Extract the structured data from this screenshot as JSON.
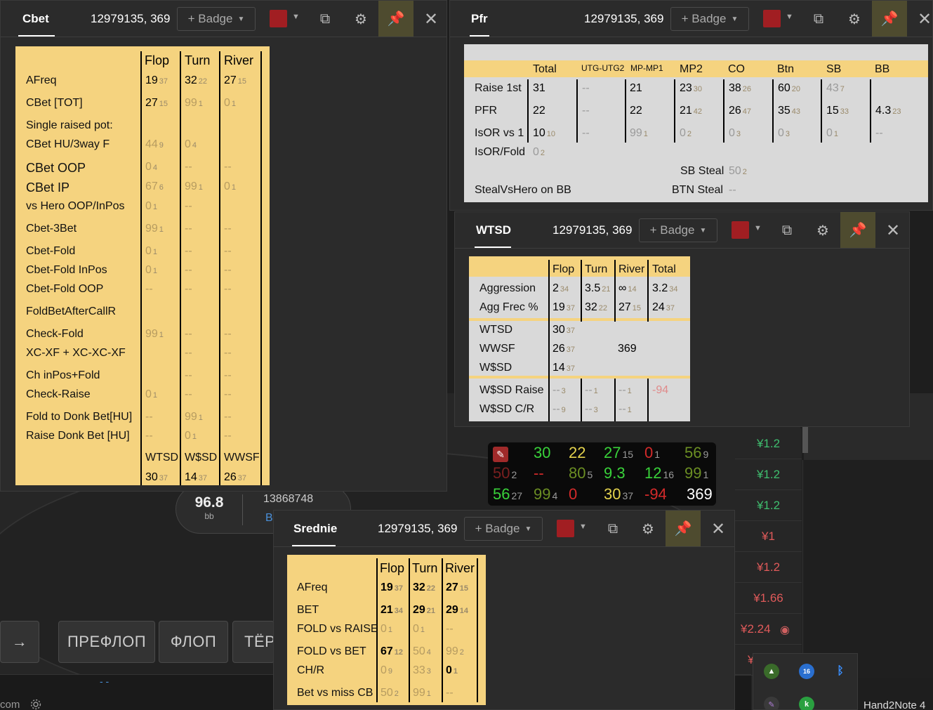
{
  "background": {
    "pot_bb": "96.8",
    "pot_unit": "bb",
    "table_id": "13868748",
    "table_b": "B",
    "arrow_btn": "→",
    "street_buttons": [
      "ПРЕФЛОП",
      "ФЛОП",
      "ТЁР"
    ],
    "bottom_text": "com",
    "dash": "- -",
    "right_values": [
      "¥1.2",
      "¥1.2",
      "¥1.2",
      "¥1",
      "¥1.2",
      "¥1.66",
      "¥2.24",
      "¥"
    ],
    "tray_badge": "16",
    "app_name": "Hand2Note 4"
  },
  "hud": {
    "rows": [
      [
        {
          "v": "30",
          "c": "c-g"
        },
        {
          "v": "22",
          "c": "c-y"
        },
        {
          "v": "27",
          "s": "15",
          "c": "c-g"
        },
        {
          "v": "0",
          "s": "1",
          "c": "c-r"
        },
        {
          "v": "56",
          "s": "9",
          "c": "c-ol"
        }
      ],
      [
        {
          "v": "50",
          "s": "2",
          "c": "c-dr"
        },
        {
          "v": "--",
          "c": "c-r"
        },
        {
          "v": "80",
          "s": "5",
          "c": "c-ol"
        },
        {
          "v": "9.3",
          "c": "c-g"
        },
        {
          "v": "12",
          "s": "16",
          "c": "c-g"
        },
        {
          "v": "99",
          "s": "1",
          "c": "c-ol"
        }
      ],
      [
        {
          "v": "56",
          "s": "27",
          "c": "c-g"
        },
        {
          "v": "99",
          "s": "4",
          "c": "c-ol"
        },
        {
          "v": "0",
          "c": "c-r"
        },
        {
          "v": "30",
          "s": "37",
          "c": "c-y"
        },
        {
          "v": "-94",
          "c": "c-r"
        },
        {
          "v": "369",
          "c": "c-w"
        }
      ]
    ]
  },
  "cbet": {
    "title": "Cbet",
    "player": "12979135, 369",
    "badge": "+ Badge",
    "headers": [
      "Flop",
      "Turn",
      "River"
    ],
    "rows": [
      {
        "label": "AFreq",
        "cells": [
          [
            "19",
            "37"
          ],
          [
            "32",
            "22"
          ],
          [
            "27",
            "15"
          ]
        ]
      },
      {
        "label": "CBet [TOT]",
        "cells": [
          [
            "27",
            "15"
          ],
          [
            "99",
            "1",
            "d"
          ],
          [
            "0",
            "1",
            "d"
          ]
        ]
      },
      {
        "label": "Single raised pot:",
        "cells": []
      },
      {
        "label": "CBet HU/3way F",
        "cells": [
          [
            "44",
            "9",
            "d"
          ],
          [
            "0",
            "4",
            "d"
          ],
          null
        ]
      },
      {
        "label": "CBet OOP",
        "cells": [
          [
            "0",
            "4",
            "d"
          ],
          [
            "--",
            "",
            "d"
          ],
          [
            "--",
            "",
            "d"
          ]
        ]
      },
      {
        "label": "CBet IP",
        "cells": [
          [
            "67",
            "6",
            "d"
          ],
          [
            "99",
            "1",
            "d"
          ],
          [
            "0",
            "1",
            "d"
          ]
        ]
      },
      {
        "label": "vs Hero OOP/InPos",
        "cells": [
          [
            "0",
            "1",
            "d"
          ],
          [
            "--",
            "",
            "d"
          ],
          null
        ]
      },
      {
        "label": "Cbet-3Bet",
        "cells": [
          [
            "99",
            "1",
            "d"
          ],
          [
            "--",
            "",
            "d"
          ],
          [
            "--",
            "",
            "d"
          ]
        ]
      },
      {
        "label": "Cbet-Fold",
        "cells": [
          [
            "0",
            "1",
            "d"
          ],
          [
            "--",
            "",
            "d"
          ],
          [
            "--",
            "",
            "d"
          ]
        ]
      },
      {
        "label": "Cbet-Fold InPos",
        "cells": [
          [
            "0",
            "1",
            "d"
          ],
          [
            "--",
            "",
            "d"
          ],
          [
            "--",
            "",
            "d"
          ]
        ]
      },
      {
        "label": "Cbet-Fold OOP",
        "cells": [
          [
            "--",
            "",
            "d"
          ],
          [
            "--",
            "",
            "d"
          ],
          [
            "--",
            "",
            "d"
          ]
        ]
      },
      {
        "label": "FoldBetAfterCallR",
        "cells": []
      },
      {
        "label": "Check-Fold",
        "cells": [
          [
            "99",
            "1",
            "d"
          ],
          [
            "--",
            "",
            "d"
          ],
          [
            "--",
            "",
            "d"
          ]
        ]
      },
      {
        "label": "XC-XF + XC-XC-XF",
        "cells": [
          null,
          [
            "--",
            "",
            "d"
          ],
          [
            "--",
            "",
            "d"
          ]
        ]
      },
      {
        "label": "Ch inPos+Fold",
        "cells": [
          null,
          [
            "--",
            "",
            "d"
          ],
          [
            "--",
            "",
            "d"
          ]
        ]
      },
      {
        "label": "Check-Raise",
        "cells": [
          [
            "0",
            "1",
            "d"
          ],
          [
            "--",
            "",
            "d"
          ],
          [
            "--",
            "",
            "d"
          ]
        ]
      },
      {
        "label": "Fold to Donk Bet[HU]",
        "cells": [
          [
            "--",
            "",
            "d"
          ],
          [
            "99",
            "1",
            "d"
          ],
          [
            "--",
            "",
            "d"
          ]
        ]
      },
      {
        "label": "Raise Donk Bet [HU]",
        "cells": [
          [
            "--",
            "",
            "d"
          ],
          [
            "0",
            "1",
            "d"
          ],
          [
            "--",
            "",
            "d"
          ]
        ]
      }
    ],
    "footer_headers": [
      "WTSD",
      "W$SD",
      "WWSF"
    ],
    "footer_values": [
      [
        "30",
        "37"
      ],
      [
        "14",
        "37"
      ],
      [
        "26",
        "37"
      ]
    ]
  },
  "pfr": {
    "title": "Pfr",
    "player": "12979135, 369",
    "badge": "+ Badge",
    "headers": [
      "Total",
      "UTG-UTG2",
      "MP-MP1",
      "MP2",
      "CO",
      "Btn",
      "SB",
      "BB"
    ],
    "rows": [
      {
        "label": "Raise 1st",
        "cells": [
          [
            "31",
            ""
          ],
          [
            "--",
            "",
            "g"
          ],
          [
            "21",
            ""
          ],
          [
            "23",
            "30"
          ],
          [
            "38",
            "26"
          ],
          [
            "60",
            "20"
          ],
          [
            "43",
            "7",
            "g"
          ],
          null
        ]
      },
      {
        "label": "PFR",
        "cells": [
          [
            "22",
            ""
          ],
          [
            "--",
            "",
            "g"
          ],
          [
            "22",
            ""
          ],
          [
            "21",
            "42"
          ],
          [
            "26",
            "47"
          ],
          [
            "35",
            "43"
          ],
          [
            "15",
            "33"
          ],
          [
            "4.3",
            "23"
          ]
        ]
      },
      {
        "label": "IsOR vs 1",
        "cells": [
          [
            "10",
            "10"
          ],
          [
            "--",
            "",
            "g"
          ],
          [
            "99",
            "1",
            "g"
          ],
          [
            "0",
            "2",
            "g"
          ],
          [
            "0",
            "3",
            "g"
          ],
          [
            "0",
            "3",
            "g"
          ],
          [
            "0",
            "1",
            "g"
          ],
          [
            "--",
            "",
            "g"
          ]
        ]
      }
    ],
    "isor_fold_label": "IsOR/Fold",
    "isor_fold_val": [
      "0",
      "2"
    ],
    "sb_steal_label": "SB Steal",
    "sb_steal_val": [
      "50",
      "2"
    ],
    "steal_vs_hero_label": "StealVsHero on BB",
    "btn_steal_label": "BTN Steal",
    "btn_steal_val": "--"
  },
  "wtsd": {
    "title": "WTSD",
    "player": "12979135, 369",
    "badge": "+ Badge",
    "headers": [
      "Flop",
      "Turn",
      "River",
      "Total"
    ],
    "rows1": [
      {
        "label": "Aggression",
        "cells": [
          [
            "2",
            "34"
          ],
          [
            "3.5",
            "21"
          ],
          [
            "∞",
            "14"
          ],
          [
            "3.2",
            "34"
          ]
        ]
      },
      {
        "label": "Agg Frec %",
        "cells": [
          [
            "19",
            "37"
          ],
          [
            "32",
            "22"
          ],
          [
            "27",
            "15"
          ],
          [
            "24",
            "37"
          ]
        ]
      }
    ],
    "rows2": [
      {
        "label": "WTSD",
        "val": [
          "30",
          "37"
        ]
      },
      {
        "label": "WWSF",
        "val": [
          "26",
          "37"
        ]
      },
      {
        "label": "W$SD",
        "val": [
          "14",
          "37"
        ]
      }
    ],
    "hands": "369",
    "rows3": [
      {
        "label": "W$SD Raise",
        "cells": [
          [
            "--",
            "3"
          ],
          [
            "--",
            "1"
          ],
          [
            "--",
            "1"
          ],
          [
            "-94",
            ""
          ]
        ]
      },
      {
        "label": "W$SD C/R",
        "cells": [
          [
            "--",
            "9"
          ],
          [
            "--",
            "3"
          ],
          [
            "--",
            "1"
          ]
        ]
      }
    ]
  },
  "srednie": {
    "title": "Srednie",
    "player": "12979135, 369",
    "badge": "+ Badge",
    "headers": [
      "Flop",
      "Turn",
      "River"
    ],
    "rows": [
      {
        "label": "AFreq",
        "cells": [
          [
            "19",
            "37"
          ],
          [
            "32",
            "22"
          ],
          [
            "27",
            "15"
          ]
        ]
      },
      {
        "label": "BET",
        "cells": [
          [
            "21",
            "34"
          ],
          [
            "29",
            "21"
          ],
          [
            "29",
            "14"
          ]
        ]
      },
      {
        "label": "FOLD vs RAISE",
        "cells": [
          [
            "0",
            "1",
            "d"
          ],
          [
            "0",
            "1",
            "d"
          ],
          [
            "--",
            "",
            "d"
          ]
        ]
      },
      {
        "label": "FOLD vs BET",
        "cells": [
          [
            "67",
            "12"
          ],
          [
            "50",
            "4",
            "d"
          ],
          [
            "99",
            "2",
            "d"
          ]
        ]
      },
      {
        "label": "CH/R",
        "cells": [
          [
            "0",
            "9",
            "d"
          ],
          [
            "33",
            "3",
            "d"
          ],
          [
            "0",
            "1"
          ]
        ]
      },
      {
        "label": "Bet vs miss CB",
        "cells": [
          [
            "50",
            "2",
            "d"
          ],
          [
            "99",
            "1",
            "d"
          ],
          [
            "--",
            "",
            "d"
          ]
        ]
      }
    ]
  }
}
